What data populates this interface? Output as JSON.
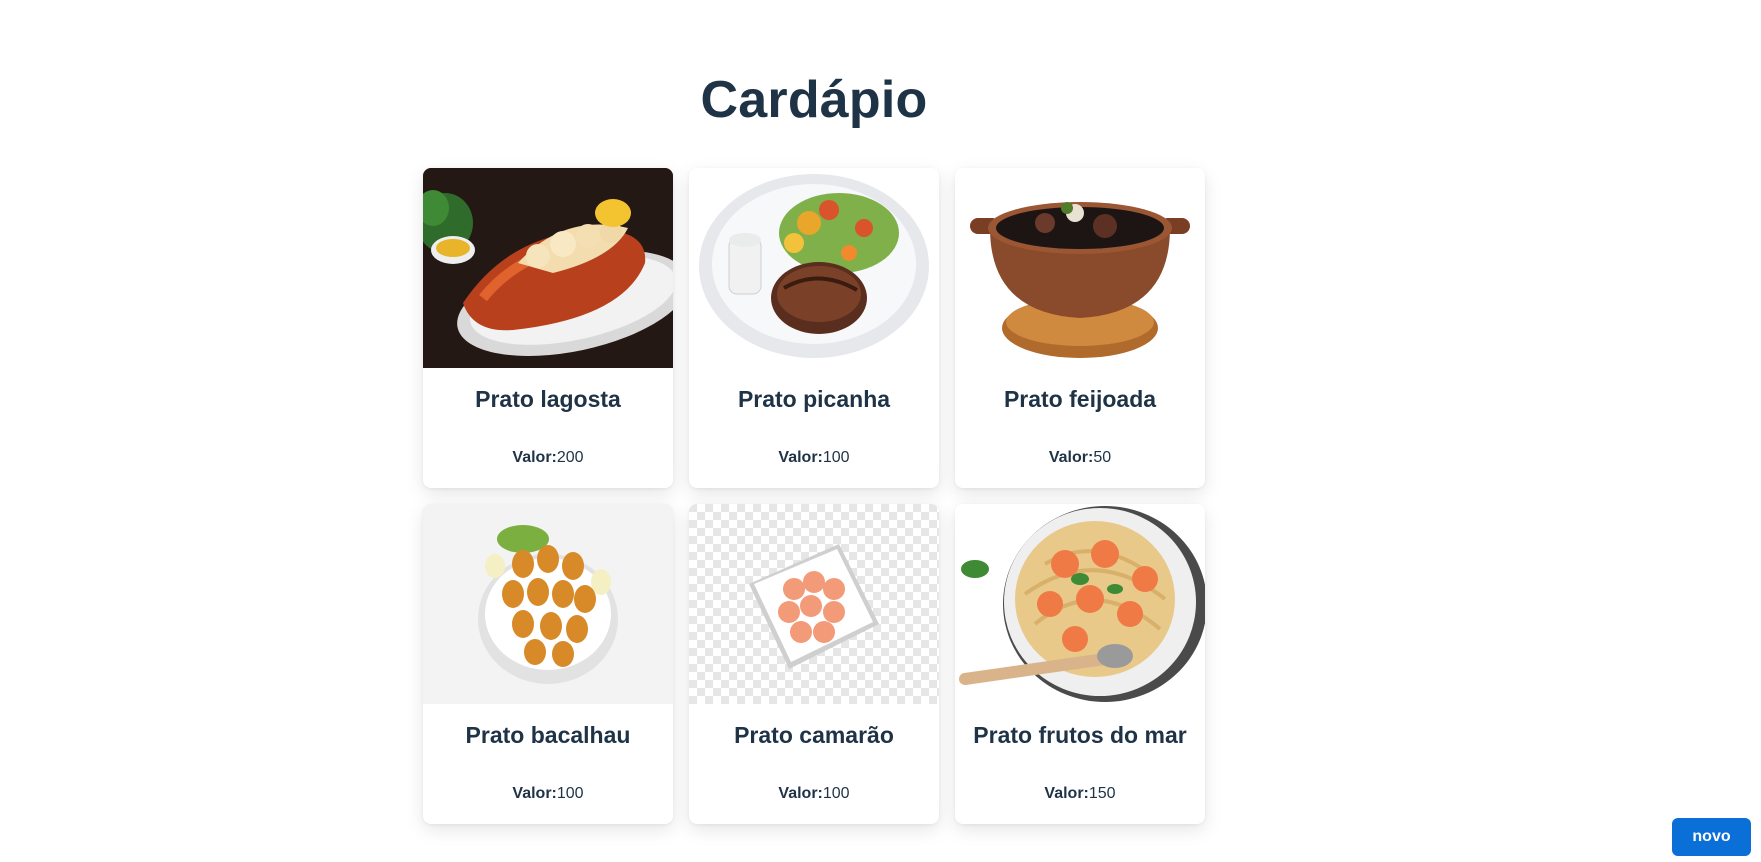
{
  "page": {
    "title": "Cardápio"
  },
  "menu": {
    "price_label": "Valor:",
    "items": [
      {
        "name": "Prato lagosta",
        "price": "200",
        "image": "lobster-dish-image"
      },
      {
        "name": "Prato picanha",
        "price": "100",
        "image": "picanha-dish-image"
      },
      {
        "name": "Prato feijoada",
        "price": "50",
        "image": "feijoada-dish-image"
      },
      {
        "name": "Prato bacalhau",
        "price": "100",
        "image": "bacalhau-dish-image"
      },
      {
        "name": "Prato camarão",
        "price": "100",
        "image": "shrimp-dish-image"
      },
      {
        "name": "Prato frutos do mar",
        "price": "150",
        "image": "seafood-pasta-dish-image"
      }
    ]
  },
  "actions": {
    "new_label": "novo"
  },
  "colors": {
    "title": "#1f3347",
    "button": "#0b6fd8",
    "button_text": "#ffffff",
    "background": "#ffffff"
  }
}
